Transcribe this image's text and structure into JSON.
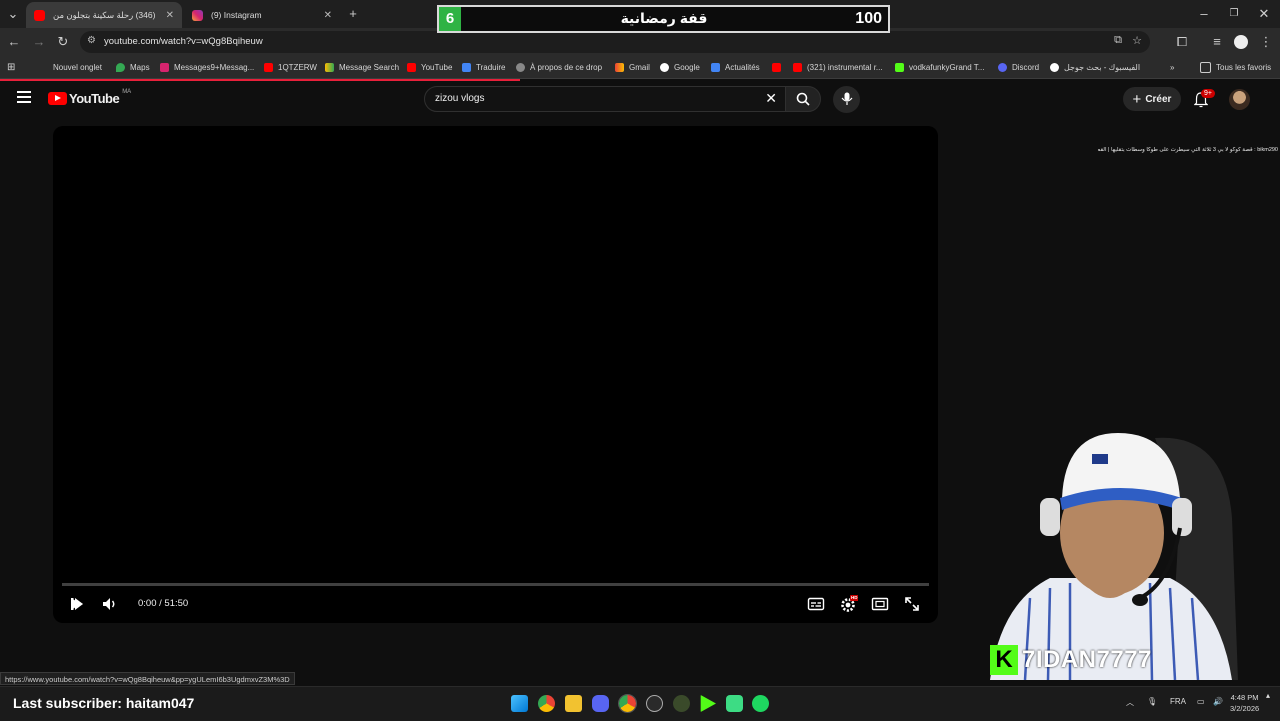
{
  "browser": {
    "tabs": [
      {
        "label": "(346) رحلة سكينة بتجلون من",
        "active": true
      },
      {
        "label": "(9) Instagram",
        "active": false
      }
    ],
    "new_tab_label": "+",
    "url": "youtube.com/watch?v=wQg8Bqiheuw",
    "bookmarks": [
      "Nouvel onglet",
      "Maps",
      "Messages9+Messag...",
      "1QTZERW",
      "Message Search",
      "YouTube",
      "Traduire",
      "À propos de ce drop",
      "Gmail",
      "Google",
      "Actualités",
      "",
      "(321) instrumental r...",
      "vodkafunkyGrand T...",
      "Discord",
      "الفيسبوك - بحث جوجل"
    ],
    "bookmarks_all": "Tous les favoris",
    "status_url": "https://www.youtube.com/watch?v=wQg8Bqiheuw&pp=ygULemI6b3UgdmxvZ3M%3D"
  },
  "overlay": {
    "score_left": "6",
    "score_title": "قفة رمضانية",
    "score_right": "100",
    "ticker": "bikm290 : قصة كوكو لا بي 3 ثلاثة التي سيطرت على طوكا وسطات بتقليها | القصة الكاملة",
    "streamer_name": "7IDAN7777",
    "streamer_logo": "K"
  },
  "youtube": {
    "logo_text": "YouTube",
    "region": "MA",
    "search_value": "zizou vlogs",
    "create_label": "Créer",
    "notif_badge": "9+"
  },
  "player": {
    "time": "0:00 / 51:50",
    "progress_fraction": 0.0,
    "hd_badge": "HD"
  },
  "taskbar": {
    "last_subscriber": "Last subscriber: haitam047",
    "lang": "FRA",
    "time": "4:48 PM",
    "date": "3/2/2026"
  },
  "colors": {
    "yt_red": "#ff0000",
    "kick_green": "#53fc18",
    "score_green": "#2fb344"
  }
}
